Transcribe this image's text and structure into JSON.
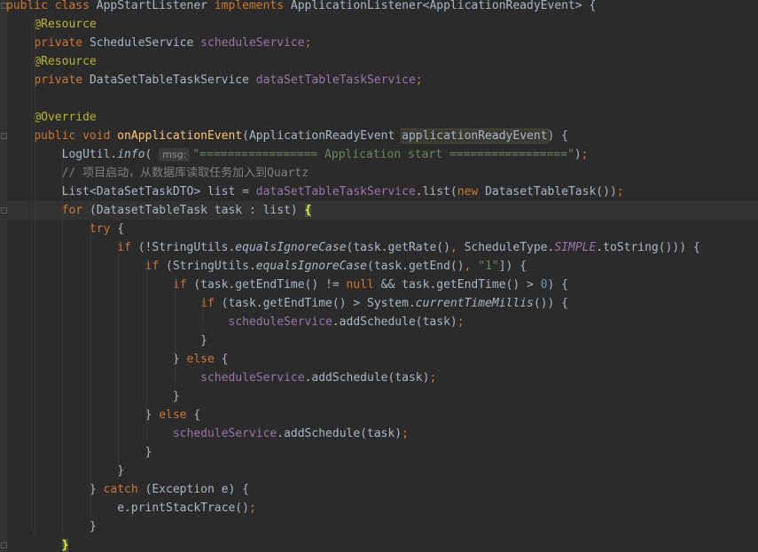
{
  "editor": {
    "lines": [
      [
        [
          "kw",
          "public class "
        ],
        [
          "",
          "AppStartListener "
        ],
        [
          "kw",
          "implements "
        ],
        [
          "",
          "ApplicationListener<ApplicationReadyEvent> {"
        ]
      ],
      [
        [
          "",
          "    "
        ],
        [
          "an",
          "@Resource"
        ]
      ],
      [
        [
          "",
          "    "
        ],
        [
          "kw",
          "private "
        ],
        [
          "",
          "ScheduleService "
        ],
        [
          "fld",
          "scheduleService"
        ],
        [
          "kw",
          ";"
        ]
      ],
      [
        [
          "",
          "    "
        ],
        [
          "an",
          "@Resource"
        ]
      ],
      [
        [
          "",
          "    "
        ],
        [
          "kw",
          "private "
        ],
        [
          "",
          "DataSetTableTaskService "
        ],
        [
          "fld",
          "dataSetTableTaskService"
        ],
        [
          "kw",
          ";"
        ]
      ],
      [],
      [
        [
          "",
          "    "
        ],
        [
          "an",
          "@Override"
        ]
      ],
      [
        [
          "",
          "    "
        ],
        [
          "kw",
          "public void "
        ],
        [
          "fn",
          "onApplicationEvent"
        ],
        [
          "",
          "(ApplicationReadyEvent "
        ],
        [
          "sel",
          "applicationReadyEvent"
        ],
        [
          "",
          ") {"
        ]
      ],
      [
        [
          "",
          "        LogUtil."
        ],
        [
          "it",
          "info"
        ],
        [
          "",
          "( "
        ],
        [
          "hint",
          "msg:"
        ],
        [
          "str",
          "\"================= Application start =================\""
        ],
        [
          "",
          ")"
        ],
        [
          "kw",
          ";"
        ]
      ],
      [
        [
          "",
          "        "
        ],
        [
          "cm",
          "// 项目启动，从数据库读取任务加入到Quartz"
        ]
      ],
      [
        [
          "",
          "        List<DataSetTaskDTO> list = "
        ],
        [
          "fld",
          "dataSetTableTaskService"
        ],
        [
          "",
          ".list("
        ],
        [
          "kw",
          "new "
        ],
        [
          "",
          "DatasetTableTask())"
        ],
        [
          "kw",
          ";"
        ]
      ],
      [
        [
          "",
          "        "
        ],
        [
          "kw",
          "for "
        ],
        [
          "",
          "(DatasetTableTask task : list) "
        ],
        [
          "brace-hl",
          "{"
        ]
      ],
      [
        [
          "",
          "            "
        ],
        [
          "kw",
          "try "
        ],
        [
          "",
          "{"
        ]
      ],
      [
        [
          "",
          "                "
        ],
        [
          "kw",
          "if "
        ],
        [
          "",
          "(!StringUtils."
        ],
        [
          "it",
          "equalsIgnoreCase"
        ],
        [
          "",
          "(task.getRate()"
        ],
        [
          "kw",
          ", "
        ],
        [
          "",
          "ScheduleType."
        ],
        [
          "st",
          "SIMPLE"
        ],
        [
          "",
          ".toString())) {"
        ]
      ],
      [
        [
          "",
          "                    "
        ],
        [
          "kw",
          "if "
        ],
        [
          "",
          "(StringUtils."
        ],
        [
          "it",
          "equalsIgnoreCase"
        ],
        [
          "",
          "(task.getEnd()"
        ],
        [
          "kw",
          ", "
        ],
        [
          "str",
          "\"1\""
        ],
        [
          "",
          "]) {"
        ]
      ],
      [
        [
          "",
          "                        "
        ],
        [
          "kw",
          "if "
        ],
        [
          "",
          "(task.getEndTime() != "
        ],
        [
          "kw",
          "null "
        ],
        [
          "",
          "&& task.getEndTime() > "
        ],
        [
          "num",
          "0"
        ],
        [
          "",
          ") {"
        ]
      ],
      [
        [
          "",
          "                            "
        ],
        [
          "kw",
          "if "
        ],
        [
          "",
          "(task.getEndTime() > System."
        ],
        [
          "it",
          "currentTimeMillis"
        ],
        [
          "",
          "()) {"
        ]
      ],
      [
        [
          "",
          "                                "
        ],
        [
          "fld",
          "scheduleService"
        ],
        [
          "",
          ".addSchedule(task)"
        ],
        [
          "kw",
          ";"
        ]
      ],
      [
        [
          "",
          "                            }"
        ]
      ],
      [
        [
          "",
          "                        } "
        ],
        [
          "kw",
          "else "
        ],
        [
          "",
          "{"
        ]
      ],
      [
        [
          "",
          "                            "
        ],
        [
          "fld",
          "scheduleService"
        ],
        [
          "",
          ".addSchedule(task)"
        ],
        [
          "kw",
          ";"
        ]
      ],
      [
        [
          "",
          "                        }"
        ]
      ],
      [
        [
          "",
          "                    } "
        ],
        [
          "kw",
          "else "
        ],
        [
          "",
          "{"
        ]
      ],
      [
        [
          "",
          "                        "
        ],
        [
          "fld",
          "scheduleService"
        ],
        [
          "",
          ".addSchedule(task)"
        ],
        [
          "kw",
          ";"
        ]
      ],
      [
        [
          "",
          "                    }"
        ]
      ],
      [
        [
          "",
          "                }"
        ]
      ],
      [
        [
          "",
          "            } "
        ],
        [
          "kw",
          "catch "
        ],
        [
          "",
          "(Exception e) {"
        ]
      ],
      [
        [
          "",
          "                e.printStackTrace()"
        ],
        [
          "kw",
          ";"
        ]
      ],
      [
        [
          "",
          "            }"
        ]
      ],
      [
        [
          "",
          "        "
        ],
        [
          "brace-hl",
          "}"
        ]
      ]
    ]
  }
}
